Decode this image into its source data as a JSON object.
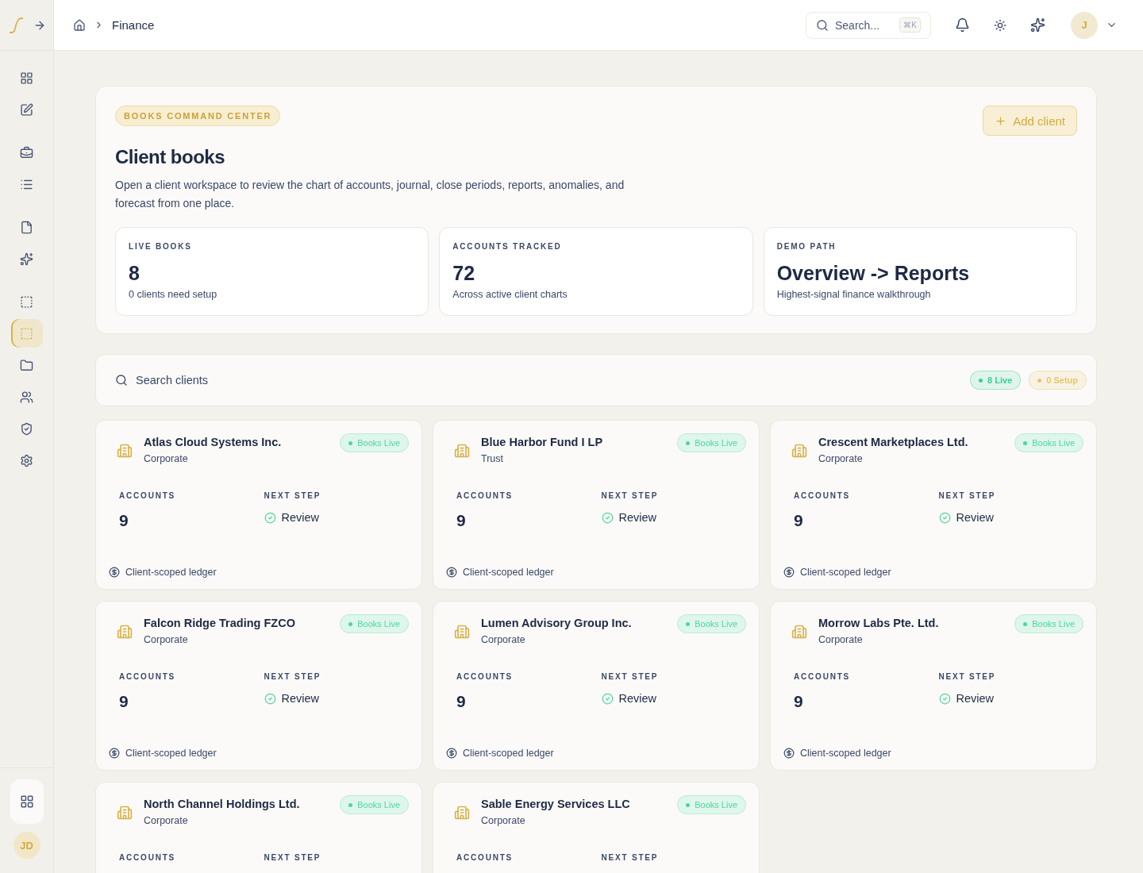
{
  "header": {
    "breadcrumb": "Finance",
    "search": {
      "placeholder": "Search...",
      "shortcut": "⌘K"
    },
    "avatar": "J"
  },
  "sidebar": {
    "items": [
      {
        "selected": false
      },
      {
        "selected": false
      },
      {
        "selected": false
      },
      {
        "selected": false
      },
      {
        "selected": false
      },
      {
        "selected": false
      },
      {
        "selected": false
      },
      {
        "selected": true
      },
      {
        "selected": false
      },
      {
        "selected": false
      },
      {
        "selected": false
      },
      {
        "selected": false
      }
    ],
    "user": "JD"
  },
  "hero": {
    "eyebrow": "BOOKS COMMAND CENTER",
    "title": "Client books",
    "description": "Open a client workspace to review the chart of accounts, journal, close periods, reports, anomalies, and forecast from one place.",
    "add_button": "Add client",
    "stats": [
      {
        "label": "LIVE BOOKS",
        "value": "8",
        "note": "0 clients need setup"
      },
      {
        "label": "ACCOUNTS TRACKED",
        "value": "72",
        "note": "Across active client charts"
      },
      {
        "label": "DEMO PATH",
        "value": "Overview -> Reports",
        "note": "Highest-signal finance walkthrough"
      }
    ]
  },
  "filter": {
    "placeholder": "Search clients",
    "chips": [
      {
        "label": "8 Live",
        "color": "#34d399"
      },
      {
        "label": "0 Setup",
        "color": "#e8c66a"
      }
    ]
  },
  "clients": [
    {
      "name": "Atlas Cloud Systems Inc.",
      "type": "Corporate",
      "status": "Books Live",
      "accounts_label": "ACCOUNTS",
      "accounts": "9",
      "next_label": "NEXT STEP",
      "next_step": "Review",
      "footer": "Client-scoped ledger"
    },
    {
      "name": "Blue Harbor Fund I LP",
      "type": "Trust",
      "status": "Books Live",
      "accounts_label": "ACCOUNTS",
      "accounts": "9",
      "next_label": "NEXT STEP",
      "next_step": "Review",
      "footer": "Client-scoped ledger"
    },
    {
      "name": "Crescent Marketplaces Ltd.",
      "type": "Corporate",
      "status": "Books Live",
      "accounts_label": "ACCOUNTS",
      "accounts": "9",
      "next_label": "NEXT STEP",
      "next_step": "Review",
      "footer": "Client-scoped ledger"
    },
    {
      "name": "Falcon Ridge Trading FZCO",
      "type": "Corporate",
      "status": "Books Live",
      "accounts_label": "ACCOUNTS",
      "accounts": "9",
      "next_label": "NEXT STEP",
      "next_step": "Review",
      "footer": "Client-scoped ledger"
    },
    {
      "name": "Lumen Advisory Group Inc.",
      "type": "Corporate",
      "status": "Books Live",
      "accounts_label": "ACCOUNTS",
      "accounts": "9",
      "next_label": "NEXT STEP",
      "next_step": "Review",
      "footer": "Client-scoped ledger"
    },
    {
      "name": "Morrow Labs Pte. Ltd.",
      "type": "Corporate",
      "status": "Books Live",
      "accounts_label": "ACCOUNTS",
      "accounts": "9",
      "next_label": "NEXT STEP",
      "next_step": "Review",
      "footer": "Client-scoped ledger"
    },
    {
      "name": "North Channel Holdings Ltd.",
      "type": "Corporate",
      "status": "Books Live",
      "accounts_label": "ACCOUNTS",
      "next_label": "NEXT STEP"
    },
    {
      "name": "Sable Energy Services LLC",
      "type": "Corporate",
      "status": "Books Live",
      "accounts_label": "ACCOUNTS",
      "next_label": "NEXT STEP"
    }
  ]
}
